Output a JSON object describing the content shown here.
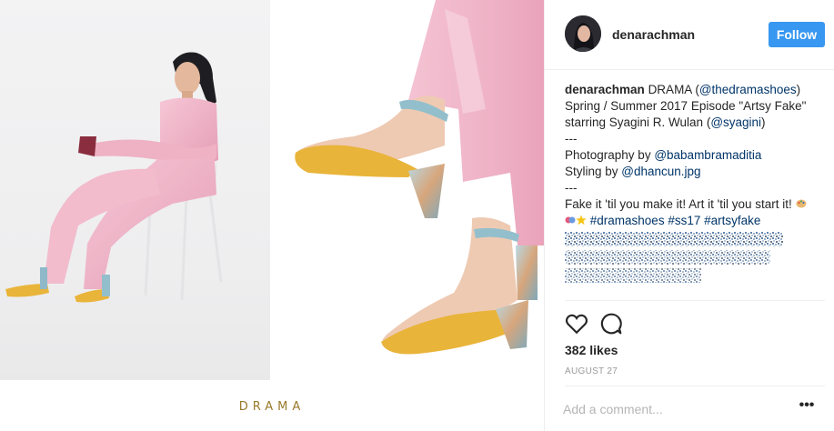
{
  "header": {
    "username": "denarachman",
    "follow_label": "Follow"
  },
  "media": {
    "brand": "DRAMA"
  },
  "caption": {
    "username": "denarachman",
    "line1_text": "DRAMA (",
    "line1_mention": "@thedramashoes",
    "line1_end": ")",
    "line2": "Spring / Summer 2017 Episode \"Artsy Fake\"",
    "line3_text": "starring Syagini R. Wulan (",
    "line3_mention": "@syagini",
    "line3_end": ")",
    "separator1": "---",
    "line5_text": "Photography by ",
    "line5_mention": "@babambramaditia",
    "line6_text": "Styling by ",
    "line6_mention": "@dhancun.jpg",
    "separator2": "---",
    "line8": "Fake it 'til you make it! Art it 'til you start it!",
    "hashtags": [
      "#dramashoes",
      "#ss17",
      "#artsyfake"
    ]
  },
  "actions": {
    "like_icon": "heart-icon",
    "comment_icon": "comment-icon"
  },
  "stats": {
    "likes": "382 likes",
    "date": "AUGUST 27"
  },
  "comment": {
    "placeholder": "Add a comment...",
    "more_label": "•••"
  },
  "colors": {
    "follow_button": "#3897f0",
    "link": "#003569",
    "brand_gold": "#9a7a2a",
    "outfit_pink": "#f0b6c8",
    "shoe_yellow": "#e9b43a"
  }
}
